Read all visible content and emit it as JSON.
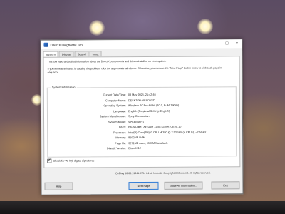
{
  "window": {
    "title": "DirectX Diagnostic Tool",
    "controls": {
      "minimize": "—",
      "maximize": "☐",
      "close": "✕"
    }
  },
  "tabs": [
    {
      "label": "System"
    },
    {
      "label": "Display"
    },
    {
      "label": "Sound"
    },
    {
      "label": "Input"
    }
  ],
  "intro": {
    "line1": "This tool reports detailed information about the DirectX components and drivers installed on your system.",
    "line2": "If you know which area is causing the problem, click the appropriate tab above. Otherwise, you can use the \"Next Page\" button below to visit each page in sequence."
  },
  "system_info": {
    "group_title": "System Information",
    "rows": [
      {
        "label": "Current Date/Time:",
        "value": "08 May 2025, 21:42:46"
      },
      {
        "label": "Computer Name:",
        "value": "DESKTOP-GE9OVSD"
      },
      {
        "label": "Operating System:",
        "value": "Windows 10 Pro 64-bit (10.0, Build 19045)"
      },
      {
        "label": "Language:",
        "value": "English (Regional Setting: English)"
      },
      {
        "label": "System Manufacturer:",
        "value": "Sony Corporation"
      },
      {
        "label": "System Model:",
        "value": "VPCEB4FFX"
      },
      {
        "label": "BIOS:",
        "value": "BIOS Date: 09/23/09 11:58:43 Ver: 08.00.10"
      },
      {
        "label": "Processor:",
        "value": "Intel(R) Core(TM) i3 CPU       M 380  @ 2.53GHz (4 CPUs), ~2.5GHz"
      },
      {
        "label": "Memory:",
        "value": "8192MB RAM"
      },
      {
        "label": "Page file:",
        "value": "3271MB used, 6503MB available"
      },
      {
        "label": "DirectX Version:",
        "value": "DirectX 12"
      }
    ]
  },
  "whql_check": {
    "label": "Check for WHQL digital signatures",
    "checked": true
  },
  "copyright": "DxDiag 10.00.19041.5794 64-bit Unicode  Copyright © Microsoft. All rights reserved.",
  "buttons": {
    "help": "Help",
    "next_page": "Next Page",
    "save_all": "Save All Information...",
    "exit": "Exit"
  }
}
